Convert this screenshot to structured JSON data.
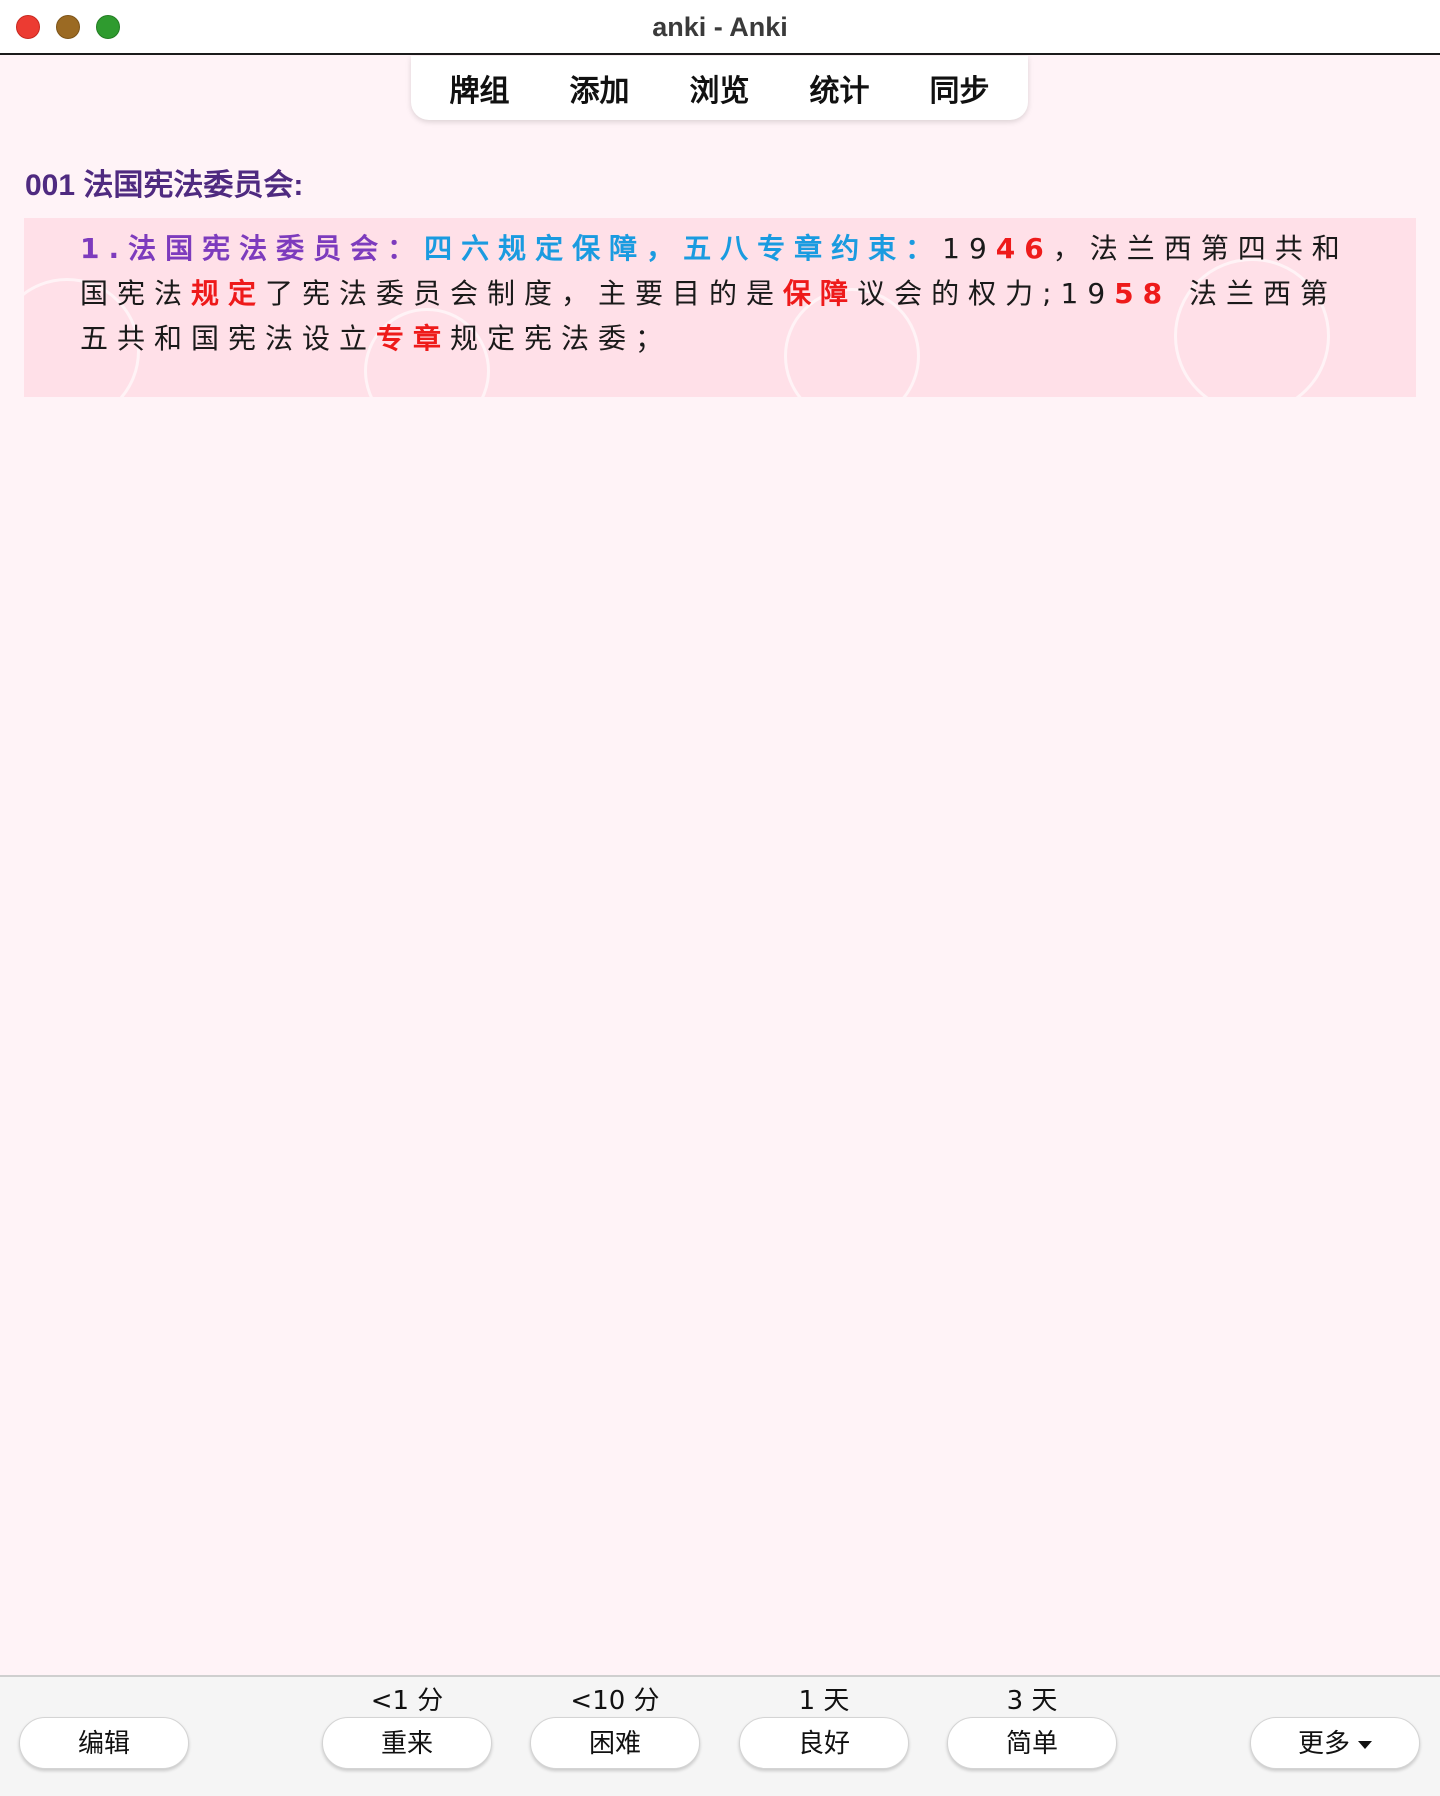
{
  "window": {
    "title": "anki - Anki"
  },
  "toolbar": {
    "items": [
      "牌组",
      "添加",
      "浏览",
      "统计",
      "同步"
    ]
  },
  "card": {
    "title": "001 法国宪法委员会:",
    "body": {
      "heading": "1.法国宪法委员会：",
      "key_phrase": "四六规定保障，五八专章约束：",
      "year1_a": "19",
      "year1_b": "46",
      "text1": "，法兰西第四共和国宪法",
      "highlight1": "规定",
      "text2": "了宪法委员会制度，主要目的是",
      "highlight2": "保障",
      "text3": "议会的权力;",
      "year2_a": "19",
      "year2_b": "58",
      "text4": "法兰西第五共和国宪法设立",
      "highlight3": "专章",
      "text5": "规定宪法委；"
    }
  },
  "bottom": {
    "edit_label": "编辑",
    "answers": [
      {
        "interval": "<1 分",
        "label": "重来"
      },
      {
        "interval": "<10 分",
        "label": "困难"
      },
      {
        "interval": "1 天",
        "label": "良好"
      },
      {
        "interval": "3 天",
        "label": "简单"
      }
    ],
    "more_label": "更多"
  }
}
